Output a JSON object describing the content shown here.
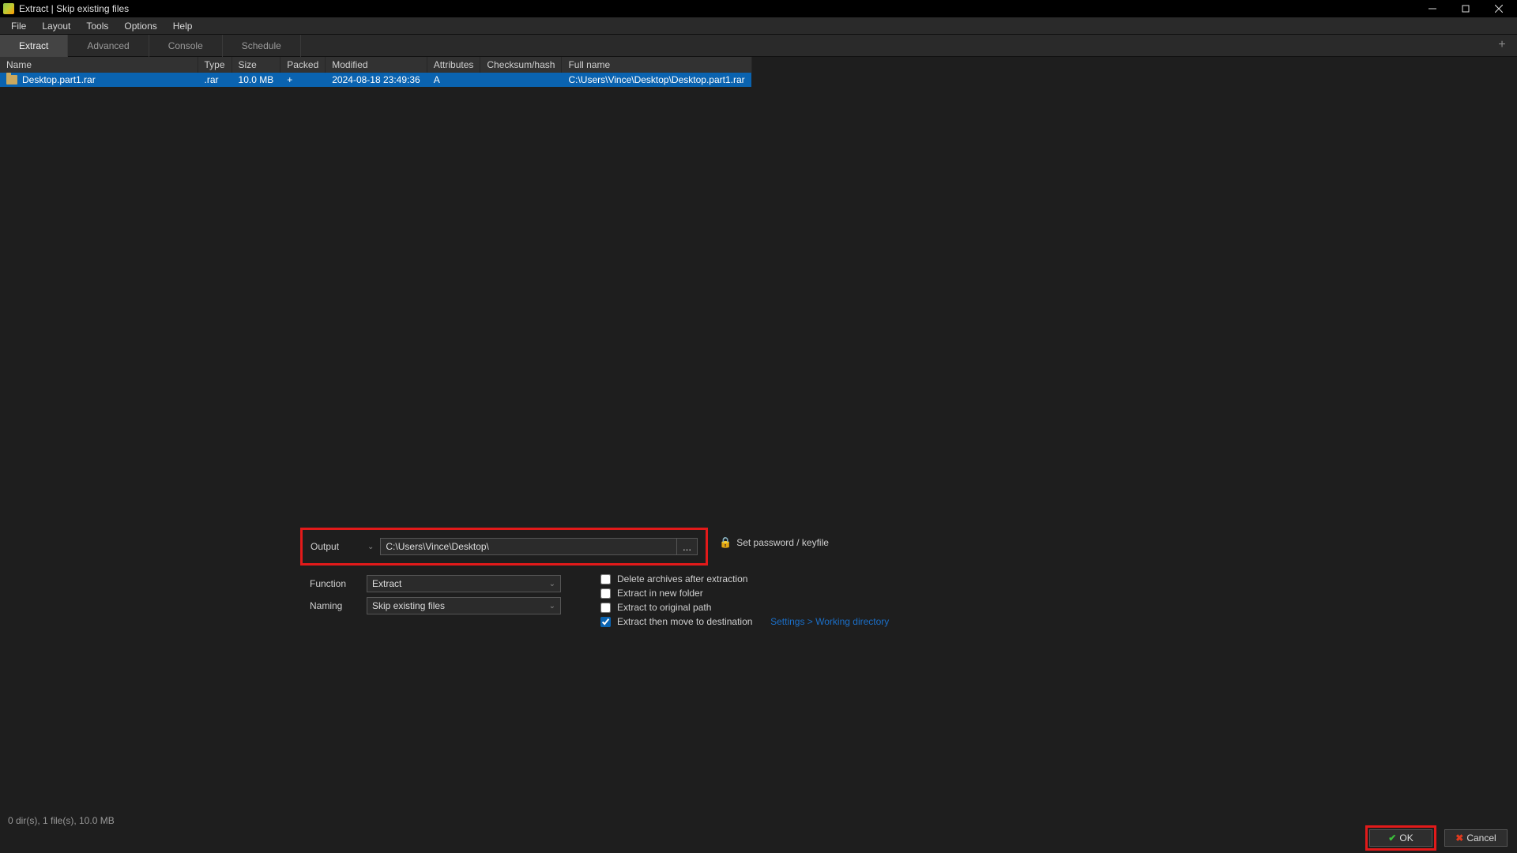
{
  "titlebar": {
    "title": "Extract | Skip existing files"
  },
  "menubar": [
    "File",
    "Layout",
    "Tools",
    "Options",
    "Help"
  ],
  "tabs": {
    "items": [
      "Extract",
      "Advanced",
      "Console",
      "Schedule"
    ],
    "active_index": 0
  },
  "columns": [
    "Name",
    "Type",
    "Size",
    "Packed",
    "Modified",
    "Attributes",
    "Checksum/hash",
    "Full name"
  ],
  "rows": [
    {
      "name": "Desktop.part1.rar",
      "type": ".rar",
      "size": "10.0 MB",
      "packed": "+",
      "modified": "2024-08-18 23:49:36",
      "attributes": "A",
      "checksum": "",
      "fullname": "C:\\Users\\Vince\\Desktop\\Desktop.part1.rar",
      "selected": true
    }
  ],
  "output": {
    "label": "Output",
    "path": "C:\\Users\\Vince\\Desktop\\",
    "browse": "...",
    "password_label": "Set password / keyfile"
  },
  "function": {
    "label": "Function",
    "value": "Extract"
  },
  "naming": {
    "label": "Naming",
    "value": "Skip existing files"
  },
  "checks": {
    "delete": {
      "label": "Delete archives after extraction",
      "checked": false
    },
    "newfolder": {
      "label": "Extract in new folder",
      "checked": false
    },
    "origpath": {
      "label": "Extract to original path",
      "checked": false
    },
    "movedest": {
      "label": "Extract then move to destination",
      "checked": true
    }
  },
  "settings_link": "Settings > Working directory",
  "status": "0 dir(s), 1 file(s), 10.0 MB",
  "buttons": {
    "ok": "OK",
    "cancel": "Cancel"
  }
}
